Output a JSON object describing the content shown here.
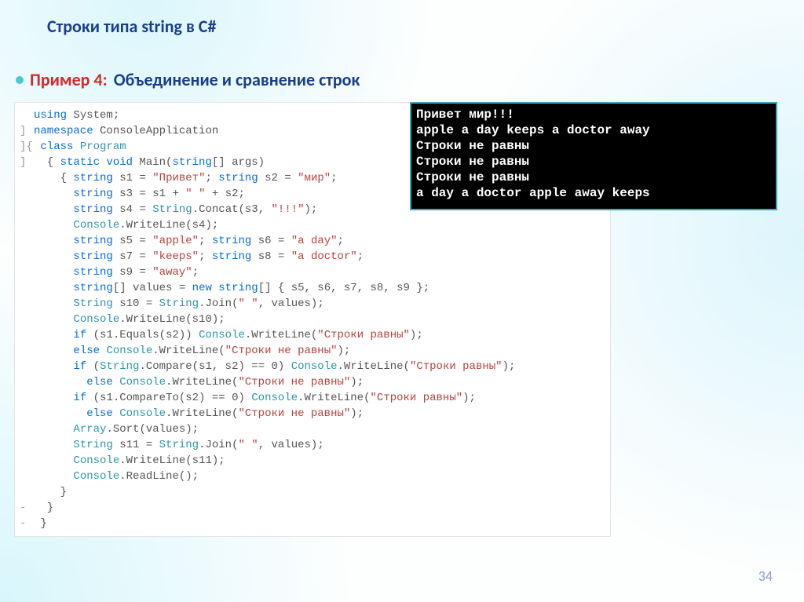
{
  "title": "Строки типа string в C#",
  "bullet": {
    "label": "Пример 4:",
    "text": "Объединение и сравнение строк"
  },
  "code": {
    "l01a": "  ",
    "l01_using": "using",
    "l01b": " System;",
    "l02g": "]",
    "l02_ns": "namespace",
    "l02b": " ConsoleApplication",
    "l03g": "]{",
    "l03_cls": " class",
    "l03b": " ",
    "l03_type": "Program",
    "l04g": "]",
    "l04a": "  { ",
    "l04_kw": "static void",
    "l04b": " Main(",
    "l04_kw2": "string",
    "l04c": "[] args)",
    "l05a": "    { ",
    "l05_kw": "string",
    "l05b": " s1 = ",
    "l05_s1": "\"Привет\"",
    "l05c": "; ",
    "l05_kw2": "string",
    "l05d": " s2 = ",
    "l05_s2": "\"мир\"",
    "l05e": ";",
    "l06a": "      ",
    "l06_kw": "string",
    "l06b": " s3 = s1 + ",
    "l06_s": "\" \"",
    "l06c": " + s2;",
    "l07a": "      ",
    "l07_kw": "string",
    "l07b": " s4 = ",
    "l07_tp": "String",
    "l07c": ".Concat(s3, ",
    "l07_s": "\"!!!\"",
    "l07d": ");",
    "l08a": "      ",
    "l08_tp": "Console",
    "l08b": ".WriteLine(s4);",
    "l09a": "      ",
    "l09_kw": "string",
    "l09b": " s5 = ",
    "l09_s1": "\"apple\"",
    "l09c": "; ",
    "l09_kw2": "string",
    "l09d": " s6 = ",
    "l09_s2": "\"a day\"",
    "l09e": ";",
    "l10a": "      ",
    "l10_kw": "string",
    "l10b": " s7 = ",
    "l10_s1": "\"keeps\"",
    "l10c": "; ",
    "l10_kw2": "string",
    "l10d": " s8 = ",
    "l10_s2": "\"a doctor\"",
    "l10e": ";",
    "l11a": "      ",
    "l11_kw": "string",
    "l11b": " s9 = ",
    "l11_s": "\"away\"",
    "l11c": ";",
    "l12a": "      ",
    "l12_kw": "string",
    "l12b": "[] values = ",
    "l12_kw2": "new string",
    "l12c": "[] { s5, s6, s7, s8, s9 };",
    "l13a": "      ",
    "l13_tp": "String",
    "l13b": " s10 = ",
    "l13_tp2": "String",
    "l13c": ".Join(",
    "l13_s": "\" \"",
    "l13d": ", values);",
    "l14a": "      ",
    "l14_tp": "Console",
    "l14b": ".WriteLine(s10);",
    "l15a": "      ",
    "l15_kw": "if",
    "l15b": " (s1.Equals(s2)) ",
    "l15_tp": "Console",
    "l15c": ".WriteLine(",
    "l15_s": "\"Строки равны\"",
    "l15d": ");",
    "l16a": "      ",
    "l16_kw": "else",
    "l16b": " ",
    "l16_tp": "Console",
    "l16c": ".WriteLine(",
    "l16_s": "\"Строки не равны\"",
    "l16d": ");",
    "l17a": "      ",
    "l17_kw": "if",
    "l17b": " (",
    "l17_tp": "String",
    "l17c": ".Compare(s1, s2) == 0) ",
    "l17_tp2": "Console",
    "l17d": ".WriteLine(",
    "l17_s": "\"Строки равны\"",
    "l17e": ");",
    "l18a": "        ",
    "l18_kw": "else",
    "l18b": " ",
    "l18_tp": "Console",
    "l18c": ".WriteLine(",
    "l18_s": "\"Строки не равны\"",
    "l18d": ");",
    "l19a": "      ",
    "l19_kw": "if",
    "l19b": " (s1.CompareTo(s2) == 0) ",
    "l19_tp": "Console",
    "l19c": ".WriteLine(",
    "l19_s": "\"Строки равны\"",
    "l19d": ");",
    "l20a": "        ",
    "l20_kw": "else",
    "l20b": " ",
    "l20_tp": "Console",
    "l20c": ".WriteLine(",
    "l20_s": "\"Строки не равны\"",
    "l20d": ");",
    "l21a": "      ",
    "l21_tp": "Array",
    "l21b": ".Sort(values);",
    "l22a": "      ",
    "l22_tp": "String",
    "l22b": " s11 = ",
    "l22_tp2": "String",
    "l22c": ".Join(",
    "l22_s": "\" \"",
    "l22d": ", values);",
    "l23a": "      ",
    "l23_tp": "Console",
    "l23b": ".WriteLine(s11);",
    "l24a": "      ",
    "l24_tp": "Console",
    "l24b": ".ReadLine();",
    "l25a": "    }",
    "l26g": "-",
    "l26a": "  }",
    "l27g": "-",
    "l27a": " }"
  },
  "console_lines": [
    "Привет мир!!!",
    "apple a day keeps a doctor away",
    "Строки не равны",
    "Строки не равны",
    "Строки не равны",
    "a day a doctor apple away keeps"
  ],
  "page": "34"
}
